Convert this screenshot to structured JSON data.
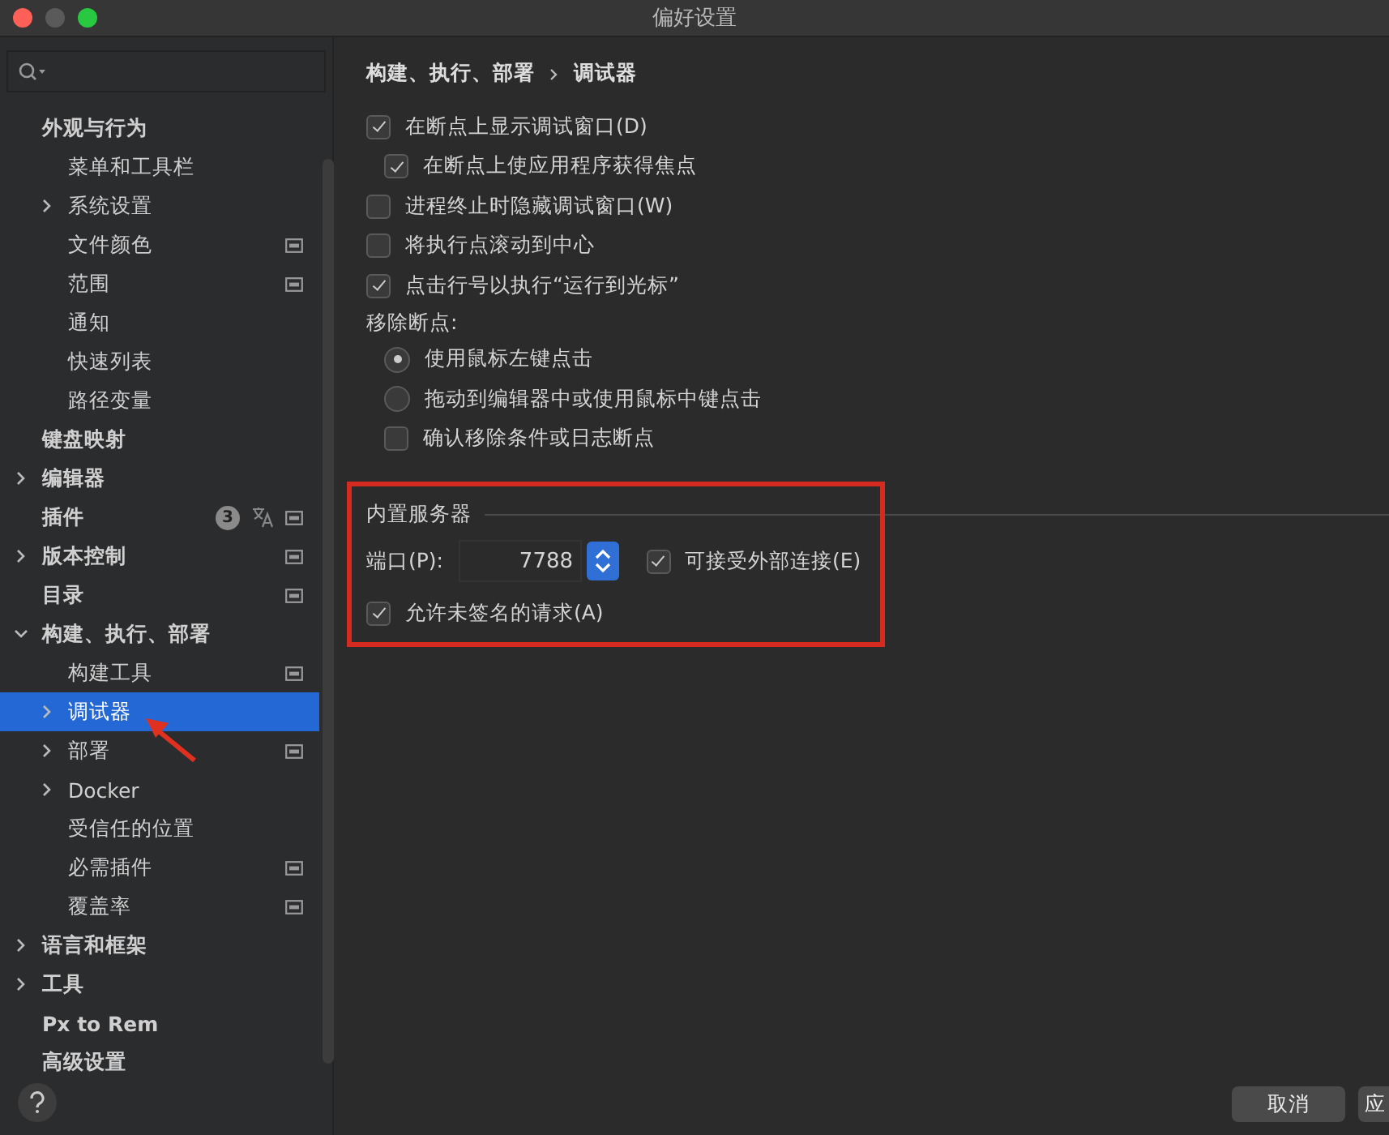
{
  "window": {
    "title": "偏好设置"
  },
  "sidebar": {
    "items": [
      {
        "label": "外观与行为",
        "children": [
          {
            "label": "菜单和工具栏",
            "selected": false
          },
          {
            "label": "系统设置",
            "expanded": false,
            "selected": false
          },
          {
            "label": "文件颜色",
            "project_icon": true,
            "selected": false
          },
          {
            "label": "范围",
            "project_icon": true,
            "selected": false
          },
          {
            "label": "通知",
            "selected": false
          },
          {
            "label": "快速列表",
            "selected": false
          },
          {
            "label": "路径变量",
            "selected": false
          }
        ],
        "selected": false
      },
      {
        "label": "键盘映射",
        "selected": false
      },
      {
        "label": "编辑器",
        "expanded": false,
        "selected": false
      },
      {
        "label": "插件",
        "badge": "3",
        "translate_icon": true,
        "project_icon": true,
        "selected": false
      },
      {
        "label": "版本控制",
        "expanded": false,
        "project_icon": true,
        "selected": false
      },
      {
        "label": "目录",
        "project_icon": true,
        "selected": false
      },
      {
        "label": "构建、执行、部署",
        "expanded": true,
        "selected": false,
        "children": [
          {
            "label": "构建工具",
            "project_icon": true,
            "selected": false
          },
          {
            "label": "调试器",
            "expanded": false,
            "selected": true,
            "annotated": true
          },
          {
            "label": "部署",
            "expanded": false,
            "project_icon": true,
            "selected": false
          },
          {
            "label": "Docker",
            "expanded": false,
            "selected": false
          },
          {
            "label": "受信任的位置",
            "selected": false
          },
          {
            "label": "必需插件",
            "project_icon": true,
            "selected": false
          },
          {
            "label": "覆盖率",
            "project_icon": true,
            "selected": false
          }
        ]
      },
      {
        "label": "语言和框架",
        "expanded": false,
        "selected": false
      },
      {
        "label": "工具",
        "expanded": false,
        "selected": false
      },
      {
        "label": "Px to Rem",
        "selected": false
      },
      {
        "label": "高级设置",
        "selected": false
      }
    ]
  },
  "breadcrumb": [
    "构建、执行、部署",
    "调试器"
  ],
  "settings": [
    {
      "kind": "checkbox",
      "label": "在断点上显示调试窗口(D)",
      "checked": true,
      "children": [
        {
          "kind": "checkbox",
          "label": "在断点上使应用程序获得焦点",
          "checked": true
        }
      ]
    },
    {
      "kind": "checkbox",
      "label": "进程终止时隐藏调试窗口(W)",
      "checked": false
    },
    {
      "kind": "checkbox",
      "label": "将执行点滚动到中心",
      "checked": false
    },
    {
      "kind": "checkbox",
      "label": "点击行号以执行“运行到光标”",
      "checked": true
    },
    {
      "kind": "heading",
      "label": "移除断点:",
      "children": [
        {
          "kind": "radio",
          "label": "使用鼠标左键点击",
          "selected": true
        },
        {
          "kind": "radio",
          "label": "拖动到编辑器中或使用鼠标中键点击",
          "selected": false
        },
        {
          "kind": "checkbox",
          "label": "确认移除条件或日志断点",
          "checked": false
        }
      ]
    }
  ],
  "server": {
    "title": "内置服务器",
    "annotated": true,
    "port_label": "端口(P):",
    "port": "7788",
    "allow_external": {
      "label": "可接受外部连接(E)",
      "checked": true
    },
    "allow_unsigned": {
      "label": "允许未签名的请求(A)",
      "checked": true
    }
  },
  "buttons": [
    "取消",
    "应"
  ]
}
